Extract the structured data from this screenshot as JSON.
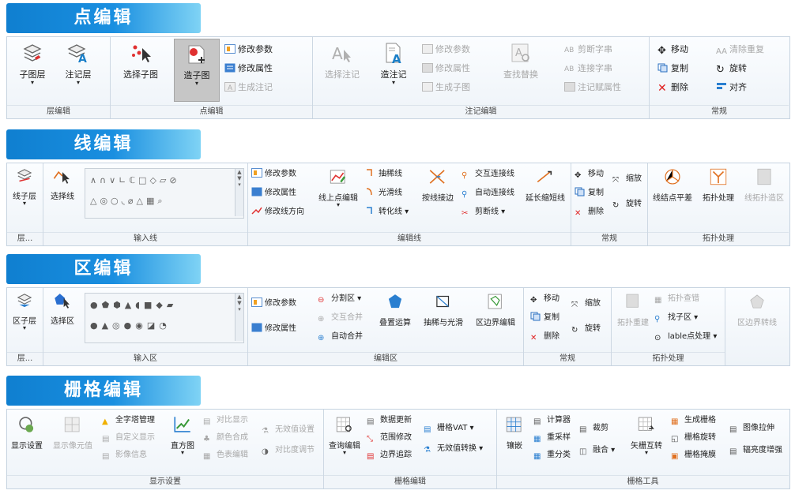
{
  "sections": {
    "point": {
      "title": "点编辑"
    },
    "line": {
      "title": "线编辑"
    },
    "region": {
      "title": "区编辑"
    },
    "raster": {
      "title": "栅格编辑"
    }
  },
  "point_ribbon": {
    "groups": [
      "层编辑",
      "点编辑",
      "注记编辑",
      "常规"
    ],
    "sublayer": "子图层",
    "annolayer": "注记层",
    "select_sub": "选择子图",
    "make_sub": "造子图",
    "modify_params": "修改参数",
    "modify_attrs": "修改属性",
    "gen_anno": "生成注记",
    "select_anno": "选择注记",
    "make_anno": "造注记",
    "anno_modify_params": "修改参数",
    "anno_modify_attrs": "修改属性",
    "anno_gen_sub": "生成子图",
    "find_replace": "查找替换",
    "cut_string": "剪断字串",
    "connect_string": "连接字串",
    "anno_assign_attr": "注记赋属性",
    "move": "移动",
    "clear_dup": "清除重复",
    "copy": "复制",
    "rotate": "旋转",
    "delete": "删除",
    "align": "对齐"
  },
  "line_ribbon": {
    "groups": [
      "层...",
      "输入线",
      "编辑线",
      "常规",
      "拓扑处理"
    ],
    "linelayer": "线子层",
    "select_line": "选择线",
    "modify_params": "修改参数",
    "modify_attrs": "修改属性",
    "modify_direction": "修改线方向",
    "line_node_edit": "线上点编辑",
    "extract_line": "抽稀线",
    "smooth_line": "光滑线",
    "convert_line": "转化线",
    "snap_join": "按线接边",
    "interactive_connect": "交互连接线",
    "auto_connect": "自动连接线",
    "cut_line": "剪断线",
    "extend_shorten": "延长缩短线",
    "move": "移动",
    "scale": "缩放",
    "copy": "复制",
    "rotate": "旋转",
    "delete": "删除",
    "node_adjust": "线结点平差",
    "topo_process": "拓扑处理",
    "line_topo_region": "线拓扑造区"
  },
  "region_ribbon": {
    "groups": [
      "层...",
      "输入区",
      "编辑区",
      "常规",
      "拓扑处理"
    ],
    "regionlayer": "区子层",
    "select_region": "选择区",
    "modify_params": "修改参数",
    "modify_attrs": "修改属性",
    "split_region": "分割区",
    "interactive_merge": "交互合并",
    "auto_merge": "自动合并",
    "overlay": "叠置运算",
    "extract_smooth": "抽稀与光滑",
    "boundary_edit": "区边界编辑",
    "move": "移动",
    "scale": "缩放",
    "copy": "复制",
    "rotate": "旋转",
    "delete": "删除",
    "topo_rebuild": "拓扑重建",
    "topo_check": "拓扑查错",
    "find_sub_region": "找子区",
    "lable_point": "lable点处理",
    "region_boundary_line": "区边界转线"
  },
  "raster_ribbon": {
    "groups": [
      "显示设置",
      "栅格编辑",
      "栅格工具"
    ],
    "display_settings": "显示设置",
    "show_cell_value": "显示像元值",
    "full_extent": "全字塔管理",
    "custom_display": "自定义显示",
    "image_info": "影像信息",
    "histogram": "直方图",
    "compare_display": "对比显示",
    "color_synthesis": "颜色合成",
    "color_table": "色表编辑",
    "nodata_settings": "无效值设置",
    "contrast": "对比度调节",
    "query_edit": "查询编辑",
    "data_update": "数据更新",
    "range_modify": "范围修改",
    "edge_trace": "边界追踪",
    "raster_vat": "栅格VAT",
    "nodata_convert": "无效值转换",
    "mosaic": "镶嵌",
    "calculator": "计算器",
    "resample": "重采样",
    "reclassify": "重分类",
    "clip": "裁剪",
    "fuse": "融合",
    "vector_convert": "矢栅互转",
    "gen_raster": "生成栅格",
    "raster_rotate": "栅格旋转",
    "raster_mask": "栅格掩膜",
    "image_stretch": "图像拉伸",
    "radiometric_enhance": "辐亮度增强"
  }
}
